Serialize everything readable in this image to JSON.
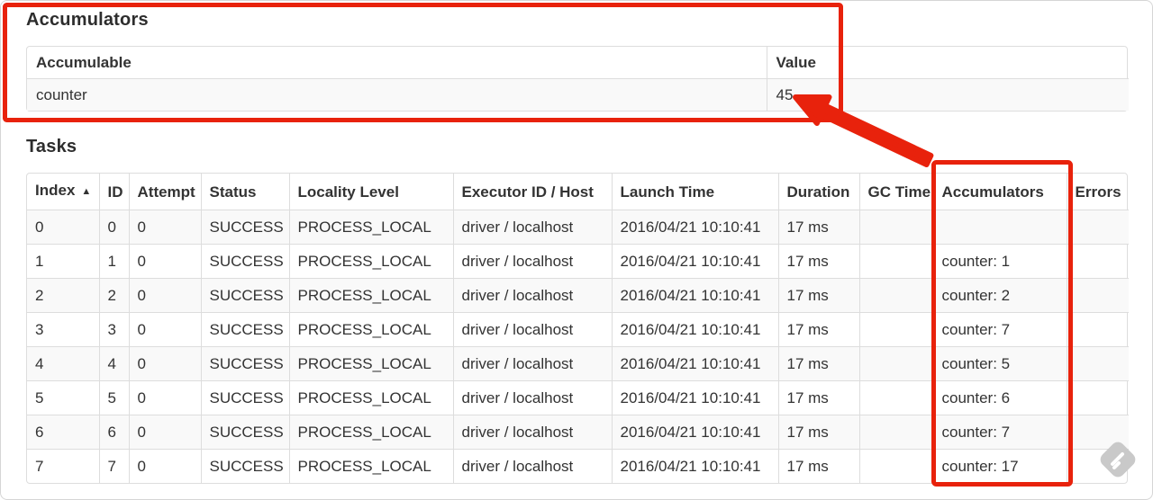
{
  "annotations": {
    "accent_red": "#e8220c",
    "watermark_gray": "#c9c9c9"
  },
  "accumulators_section": {
    "title": "Accumulators",
    "table": {
      "headers": [
        "Accumulable",
        "Value"
      ],
      "rows": [
        [
          "counter",
          "45"
        ]
      ]
    }
  },
  "tasks_section": {
    "title": "Tasks",
    "table": {
      "headers": [
        "Index",
        "ID",
        "Attempt",
        "Status",
        "Locality Level",
        "Executor ID / Host",
        "Launch Time",
        "Duration",
        "GC Time",
        "Accumulators",
        "Errors"
      ],
      "sort_icon": "▲",
      "rows": [
        [
          "0",
          "0",
          "0",
          "SUCCESS",
          "PROCESS_LOCAL",
          "driver / localhost",
          "2016/04/21 10:10:41",
          "17 ms",
          "",
          "",
          ""
        ],
        [
          "1",
          "1",
          "0",
          "SUCCESS",
          "PROCESS_LOCAL",
          "driver / localhost",
          "2016/04/21 10:10:41",
          "17 ms",
          "",
          "counter: 1",
          ""
        ],
        [
          "2",
          "2",
          "0",
          "SUCCESS",
          "PROCESS_LOCAL",
          "driver / localhost",
          "2016/04/21 10:10:41",
          "17 ms",
          "",
          "counter: 2",
          ""
        ],
        [
          "3",
          "3",
          "0",
          "SUCCESS",
          "PROCESS_LOCAL",
          "driver / localhost",
          "2016/04/21 10:10:41",
          "17 ms",
          "",
          "counter: 7",
          ""
        ],
        [
          "4",
          "4",
          "0",
          "SUCCESS",
          "PROCESS_LOCAL",
          "driver / localhost",
          "2016/04/21 10:10:41",
          "17 ms",
          "",
          "counter: 5",
          ""
        ],
        [
          "5",
          "5",
          "0",
          "SUCCESS",
          "PROCESS_LOCAL",
          "driver / localhost",
          "2016/04/21 10:10:41",
          "17 ms",
          "",
          "counter: 6",
          ""
        ],
        [
          "6",
          "6",
          "0",
          "SUCCESS",
          "PROCESS_LOCAL",
          "driver / localhost",
          "2016/04/21 10:10:41",
          "17 ms",
          "",
          "counter: 7",
          ""
        ],
        [
          "7",
          "7",
          "0",
          "SUCCESS",
          "PROCESS_LOCAL",
          "driver / localhost",
          "2016/04/21 10:10:41",
          "17 ms",
          "",
          "counter: 17",
          ""
        ]
      ]
    }
  }
}
